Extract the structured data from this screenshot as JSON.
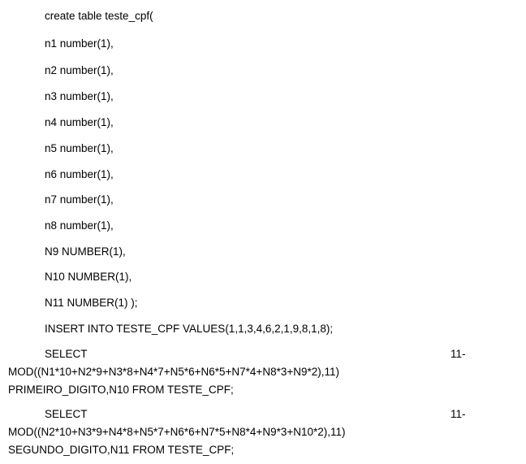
{
  "document": {
    "lines": [
      "create table teste_cpf(",
      "n1 number(1),",
      "n2 number(1),",
      "n3 number(1),",
      "n4 number(1),",
      "n5 number(1),",
      "n6 number(1),",
      "n7 number(1),",
      "n8 number(1),",
      "N9 NUMBER(1),",
      "N10 NUMBER(1),",
      "N11 NUMBER(1) );",
      "INSERT INTO TESTE_CPF VALUES(1,1,3,4,6,2,1,9,8,1,8);"
    ],
    "query1": {
      "select": "SELECT",
      "num": "11-",
      "mod": "MOD((N1*10+N2*9+N3*8+N4*7+N5*6+N6*5+N7*4+N8*3+N9*2),11)",
      "from": "PRIMEIRO_DIGITO,N10 FROM TESTE_CPF;"
    },
    "query2": {
      "select": "SELECT",
      "num": "11-",
      "mod": "MOD((N2*10+N3*9+N4*8+N5*7+N6*6+N7*5+N8*4+N9*3+N10*2),11)",
      "from": "SEGUNDO_DIGITO,N11 FROM TESTE_CPF;"
    }
  }
}
